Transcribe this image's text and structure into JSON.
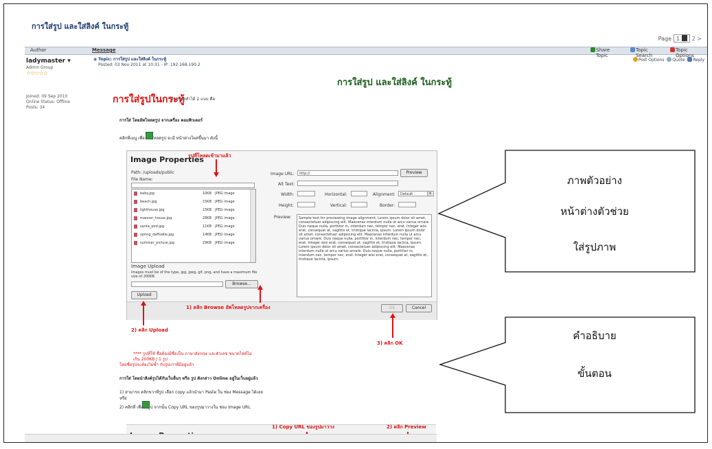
{
  "page": {
    "thread_title": "การใส่รูป และใส่ลิงค์ ในกระทู้",
    "page_label": "Page",
    "page_current": "1",
    "page_more": "2 >"
  },
  "header": {
    "author": "Author",
    "message": "Message",
    "share": "Share Topic",
    "search": "Topic Search",
    "options": "Topic Options"
  },
  "user": {
    "name": "ladymaster",
    "group": "Admin Group",
    "stars": "☆☆☆☆☆",
    "joined": "Joined: 09 Sep 2010",
    "status": "Online Status: Offline",
    "posts": "Posts: 34"
  },
  "topic": {
    "label": "Topic: การใส่รูป และใส่ลิงค์ ในกระทู้",
    "posted": "Posted: 03 Nov 2011 at 10:31 - IP: 192.168.190.2",
    "post_options": "Post Options",
    "quote": "Quote",
    "reply": "Reply"
  },
  "content": {
    "big_title": "การใส่รูป และใส่ลิงค์ ในกระทู้",
    "red_title": "การใส่รูปในกระทู้",
    "red_sub": "สามารถทำได้ 2 แบบ คือ",
    "s1": "การใส่ โดยอัพโหลดรูป จากเครื่อง คอมพิวเตอร์",
    "s2": "คลิกที่เมนู  เพื่อ อัพโหลดรูป จะมี หน้าต่างโผล่ขึ้นมา ดังนี้",
    "note1": "**** รูปที่ใช้ ชื่อต้องมีชื่อเป็น ภาษาอังกฤษ และตัวเลข ขนาดไฟล์ไม่เกิน 200KB / 1 รูป",
    "note2": "โดยชื่อรูปจะต้องไม่ซ้ำ กับรูปเก่าที่มีอยู่แล้ว",
    "s3": "การใส่ โดยนำลิงค์รูปได้กับเว็บอื่นๆ หรือ รูป ดังกล่าว Online อยู่ในเว็บอยู่แล้ว",
    "s4": "1) สามารถ คลิกขวาที่รูป เลือก copy แล้วนำมา Paste ใน ช่อง Message ได้เลย",
    "s4b": "หรือ",
    "s5": "2) คลิกที่  เพื่อใส่รูป จากนั้น Copy URL ของรูปมาวางใน ช่อง Image URL",
    "dialog2_title": "Image Properties",
    "copy_url": "1) Copy URL ของรูปมาวาง",
    "click_preview": "2) คลิก Preview"
  },
  "dialog": {
    "title": "Image Properties",
    "uploaded_note": "รูปที่โหลดเข้ามาแล้ว",
    "path": "Path: /uploads/public",
    "file_name": "File Name:",
    "files": [
      {
        "name": "baby.jpg",
        "size": "10KB",
        "type": "JPEG image"
      },
      {
        "name": "beach.jpg",
        "size": "15KB",
        "type": "JPEG image"
      },
      {
        "name": "lighthouse.jpg",
        "size": "15KB",
        "type": "JPEG image"
      },
      {
        "name": "manner_house.jpg",
        "size": "28KB",
        "type": "JPEG image"
      },
      {
        "name": "santa_pod.jpg",
        "size": "11KB",
        "type": "JPEG image"
      },
      {
        "name": "spring_daffodile.jpg",
        "size": "14KB",
        "type": "JPEG image"
      },
      {
        "name": "summer_picture.jpg",
        "size": "29KB",
        "type": "JPEG image"
      }
    ],
    "image_upload": "Image Upload",
    "upload_hint": "Images must be of the type, jpg, jpeg, gif, png, and have a maximum file size of 200KB",
    "browse": "Browse...",
    "upload": "Upload",
    "image_url_label": "Image URL:",
    "image_url_value": "http://",
    "preview_btn": "Preview",
    "alt_text": "Alt Text:",
    "width": "Width:",
    "horizontal": "Horizontal:",
    "alignment": "Alignment:",
    "alignment_value": "Default",
    "height": "Height:",
    "vertical": "Vertical:",
    "border": "Border:",
    "preview_label": "Preview:",
    "preview_text": "Sample text for previewing image alignment; Lorem ipsum dolor sit amet, consectetuer adipiscing elit. Maecenas interdum nulla ut arcu varius ornare. Duis neque nulla, porttitor in, interdum nec, tempor nec, erat. Integer wisi erat, consequat at, sagittis et, tristique lacinia, ipsum. Lorem ipsum dolor sit amet, consectetuer adipiscing elit. Maecenas interdum nulla ut arcu varius ornare. Duis neque nulla, porttitor in, interdum nec, tempor nec, erat. Integer wisi erat, consequat at, sagittis et, tristique lacinia, ipsum. Lorem ipsum dolor sit amet, consectetuer adipiscing elit. Maecenas interdum nulla ut arcu varius ornare. Duis neque nulla, porttitor in, interdum nec, tempor nec, erat. Integer wisi erat, consequat at, sagittis et, tristique lacinia, ipsum.",
    "ok": "OK",
    "cancel": "Cancel"
  },
  "annotations": {
    "browse": "1) คลิก Browse อัพโหลดรูปจากเครื่อง",
    "upload": "2) คลิก Upload",
    "ok": "3) คลิก OK"
  },
  "callouts": {
    "preview_line1": "ภาพตัวอย่าง",
    "preview_line2": "หน้าต่างตัวช่วย",
    "preview_line3": "ใส่รูปภาพ",
    "explain_line1": "คำอธิบาย",
    "explain_line2": "ขั้นตอน"
  }
}
